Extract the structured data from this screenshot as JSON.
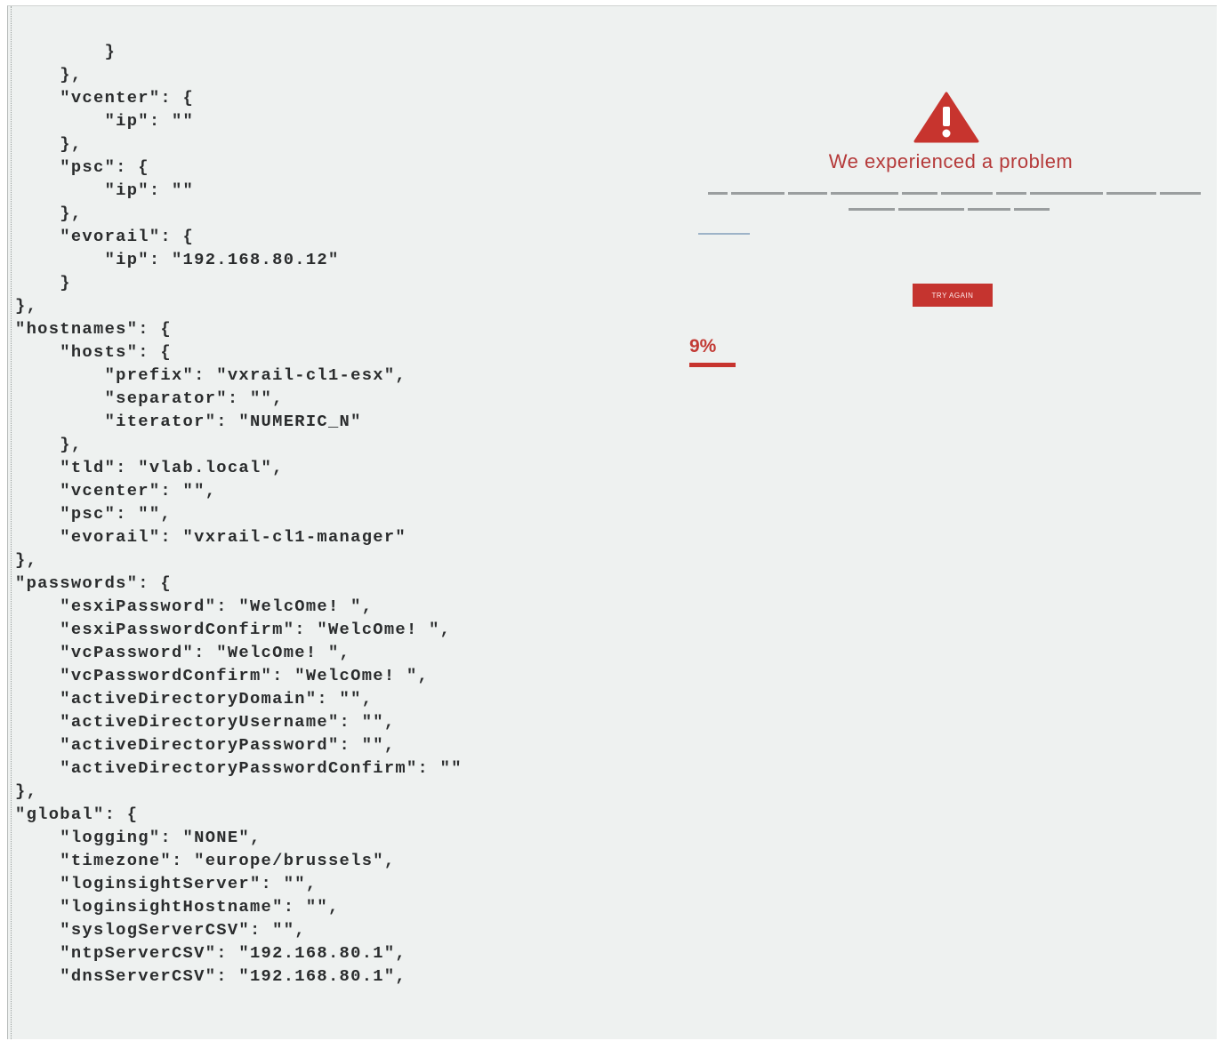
{
  "code_lines": [
    "        }",
    "    },",
    "    \"vcenter\": {",
    "        \"ip\": \"\"",
    "    },",
    "    \"psc\": {",
    "        \"ip\": \"\"",
    "    },",
    "    \"evorail\": {",
    "        \"ip\": \"192.168.80.12\"",
    "    }",
    "},",
    "\"hostnames\": {",
    "    \"hosts\": {",
    "        \"prefix\": \"vxrail-cl1-esx\",",
    "        \"separator\": \"\",",
    "        \"iterator\": \"NUMERIC_N\"",
    "    },",
    "    \"tld\": \"vlab.local\",",
    "    \"vcenter\": \"\",",
    "    \"psc\": \"\",",
    "    \"evorail\": \"vxrail-cl1-manager\"",
    "},",
    "\"passwords\": {",
    "    \"esxiPassword\": \"WelcOme! \",",
    "    \"esxiPasswordConfirm\": \"WelcOme! \",",
    "    \"vcPassword\": \"WelcOme! \",",
    "    \"vcPasswordConfirm\": \"WelcOme! \",",
    "    \"activeDirectoryDomain\": \"\",",
    "    \"activeDirectoryUsername\": \"\",",
    "    \"activeDirectoryPassword\": \"\",",
    "    \"activeDirectoryPasswordConfirm\": \"\"",
    "},",
    "\"global\": {",
    "    \"logging\": \"NONE\",",
    "    \"timezone\": \"europe/brussels\",",
    "    \"loginsightServer\": \"\",",
    "    \"loginsightHostname\": \"\",",
    "    \"syslogServerCSV\": \"\",",
    "    \"ntpServerCSV\": \"192.168.80.1\",",
    "    \"dnsServerCSV\": \"192.168.80.1\","
  ],
  "error": {
    "icon": "warning-triangle-icon",
    "title": "We experienced a problem",
    "retry_label": "TRY AGAIN"
  },
  "progress": {
    "label": "9%",
    "value": 0.09
  },
  "colors": {
    "accent": "#c7342e",
    "background": "#eef1f0",
    "code_text": "#2a2c2d"
  }
}
